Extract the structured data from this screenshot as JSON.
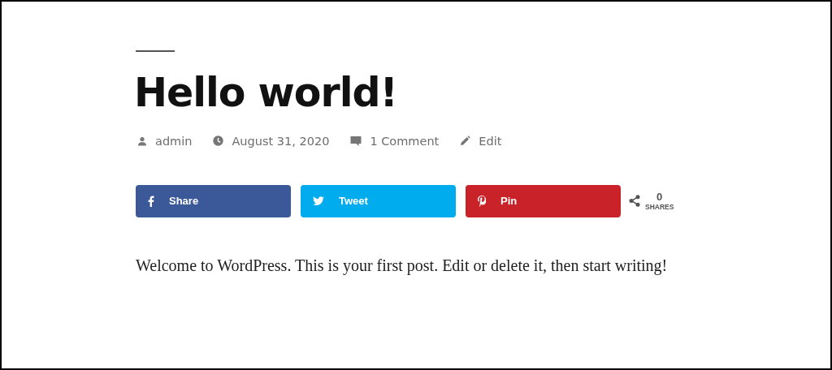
{
  "post": {
    "title": "Hello world!",
    "meta": [
      {
        "kind": "author",
        "label": "admin"
      },
      {
        "kind": "date",
        "label": "August 31, 2020"
      },
      {
        "kind": "comments",
        "label": "1 Comment"
      },
      {
        "kind": "edit",
        "label": "Edit"
      }
    ],
    "share_buttons": [
      {
        "kind": "facebook",
        "label": "Share",
        "color": "#3b5998"
      },
      {
        "kind": "twitter",
        "label": "Tweet",
        "color": "#00acee"
      },
      {
        "kind": "pinterest",
        "label": "Pin",
        "color": "#c92228"
      }
    ],
    "share_count": {
      "count": "0",
      "label": "SHARES"
    },
    "body": "Welcome to WordPress. This is your first post. Edit or delete it, then start writing!"
  }
}
